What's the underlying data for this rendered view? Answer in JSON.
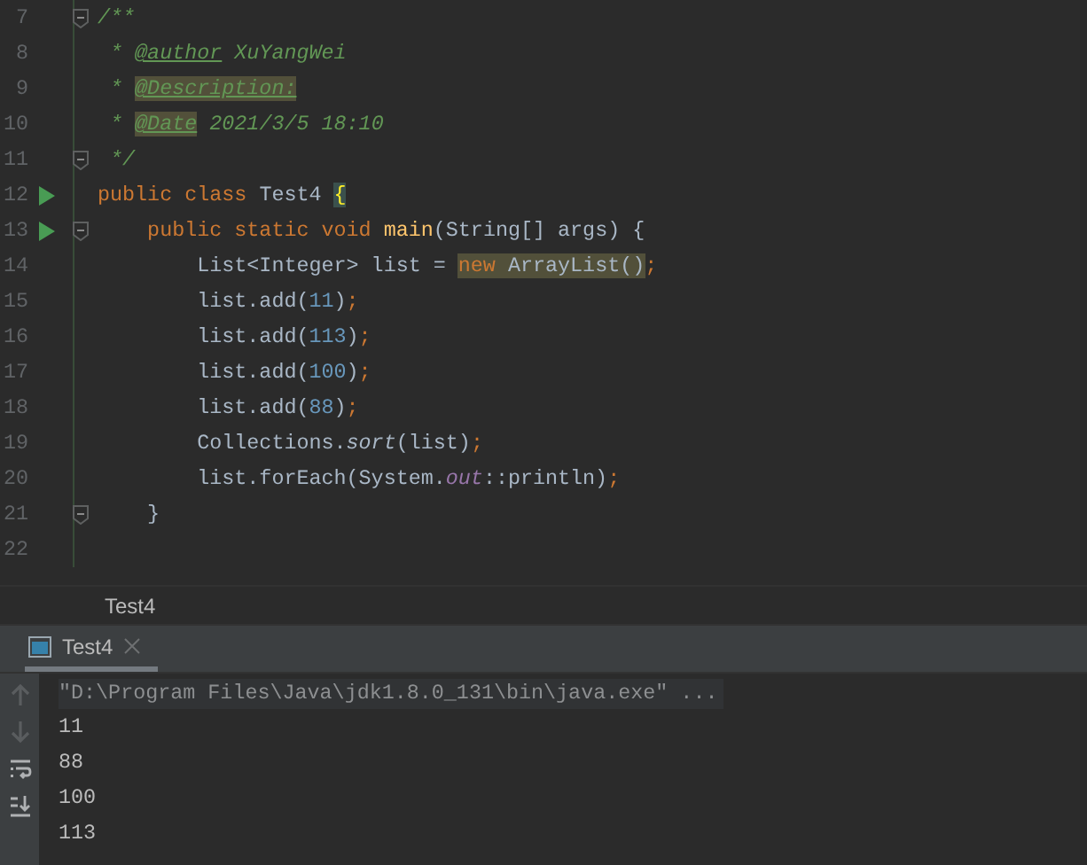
{
  "editor": {
    "lines": [
      {
        "number": "7",
        "run": false,
        "fold": true,
        "code": [
          {
            "text": "/**",
            "kind": "doc",
            "highlight": false
          }
        ]
      },
      {
        "number": "8",
        "run": false,
        "fold": false,
        "code": [
          {
            "text": " * ",
            "kind": "doc",
            "highlight": false
          },
          {
            "text": "@author",
            "kind": "doctag",
            "highlight": false
          },
          {
            "text": " XuYangWei",
            "kind": "docval",
            "highlight": false
          }
        ]
      },
      {
        "number": "9",
        "run": false,
        "fold": false,
        "code": [
          {
            "text": " * ",
            "kind": "doc",
            "highlight": false
          },
          {
            "text": "@Description:",
            "kind": "doctag",
            "highlight": true
          }
        ]
      },
      {
        "number": "10",
        "run": false,
        "fold": false,
        "code": [
          {
            "text": " * ",
            "kind": "doc",
            "highlight": false
          },
          {
            "text": "@Date",
            "kind": "doctag",
            "highlight": true
          },
          {
            "text": " 2021/3/5 18:10",
            "kind": "docval",
            "highlight": false
          }
        ]
      },
      {
        "number": "11",
        "run": false,
        "fold": true,
        "code": [
          {
            "text": " */",
            "kind": "doc",
            "highlight": false
          }
        ]
      },
      {
        "number": "12",
        "run": true,
        "fold": false,
        "code": [
          {
            "text": "public class ",
            "kind": "keyword",
            "highlight": false
          },
          {
            "text": "Test4 ",
            "kind": "plain",
            "highlight": false
          },
          {
            "text": "{",
            "kind": "brace",
            "highlight": true
          }
        ]
      },
      {
        "number": "13",
        "run": true,
        "fold": true,
        "code": [
          {
            "text": "    public static void ",
            "kind": "keyword",
            "highlight": false
          },
          {
            "text": "main",
            "kind": "method",
            "highlight": false
          },
          {
            "text": "(String[] args) {",
            "kind": "plain",
            "highlight": false
          }
        ]
      },
      {
        "number": "14",
        "run": false,
        "fold": false,
        "code": [
          {
            "text": "        List<Integer> list = ",
            "kind": "plain",
            "highlight": false
          },
          {
            "text": "new ",
            "kind": "keyword",
            "highlight": true
          },
          {
            "text": "ArrayList()",
            "kind": "plain",
            "highlight": true
          },
          {
            "text": ";",
            "kind": "keyword",
            "highlight": false
          }
        ]
      },
      {
        "number": "15",
        "run": false,
        "fold": false,
        "code": [
          {
            "text": "        list.add(",
            "kind": "plain",
            "highlight": false
          },
          {
            "text": "11",
            "kind": "number",
            "highlight": false
          },
          {
            "text": ")",
            "kind": "plain",
            "highlight": false
          },
          {
            "text": ";",
            "kind": "keyword",
            "highlight": false
          }
        ]
      },
      {
        "number": "16",
        "run": false,
        "fold": false,
        "code": [
          {
            "text": "        list.add(",
            "kind": "plain",
            "highlight": false
          },
          {
            "text": "113",
            "kind": "number",
            "highlight": false
          },
          {
            "text": ")",
            "kind": "plain",
            "highlight": false
          },
          {
            "text": ";",
            "kind": "keyword",
            "highlight": false
          }
        ]
      },
      {
        "number": "17",
        "run": false,
        "fold": false,
        "code": [
          {
            "text": "        list.add(",
            "kind": "plain",
            "highlight": false
          },
          {
            "text": "100",
            "kind": "number",
            "highlight": false
          },
          {
            "text": ")",
            "kind": "plain",
            "highlight": false
          },
          {
            "text": ";",
            "kind": "keyword",
            "highlight": false
          }
        ]
      },
      {
        "number": "18",
        "run": false,
        "fold": false,
        "code": [
          {
            "text": "        list.add(",
            "kind": "plain",
            "highlight": false
          },
          {
            "text": "88",
            "kind": "number",
            "highlight": false
          },
          {
            "text": ")",
            "kind": "plain",
            "highlight": false
          },
          {
            "text": ";",
            "kind": "keyword",
            "highlight": false
          }
        ]
      },
      {
        "number": "19",
        "run": false,
        "fold": false,
        "code": [
          {
            "text": "        Collections.",
            "kind": "plain",
            "highlight": false
          },
          {
            "text": "sort",
            "kind": "static",
            "highlight": false
          },
          {
            "text": "(list)",
            "kind": "plain",
            "highlight": false
          },
          {
            "text": ";",
            "kind": "keyword",
            "highlight": false
          }
        ]
      },
      {
        "number": "20",
        "run": false,
        "fold": false,
        "code": [
          {
            "text": "        list.forEach(System.",
            "kind": "plain",
            "highlight": false
          },
          {
            "text": "out",
            "kind": "field",
            "highlight": false
          },
          {
            "text": "::println)",
            "kind": "plain",
            "highlight": false
          },
          {
            "text": ";",
            "kind": "keyword",
            "highlight": false
          }
        ]
      },
      {
        "number": "21",
        "run": false,
        "fold": true,
        "code": [
          {
            "text": "    }",
            "kind": "plain",
            "highlight": false
          }
        ]
      },
      {
        "number": "22",
        "run": false,
        "fold": false
      }
    ]
  },
  "breadcrumb": "Test4",
  "run_panel": {
    "tabs": [
      {
        "label": "Test4",
        "selected": true
      }
    ],
    "console": {
      "command": "\"D:\\Program Files\\Java\\jdk1.8.0_131\\bin\\java.exe\" ...",
      "output": [
        "11",
        "88",
        "100",
        "113"
      ]
    }
  }
}
